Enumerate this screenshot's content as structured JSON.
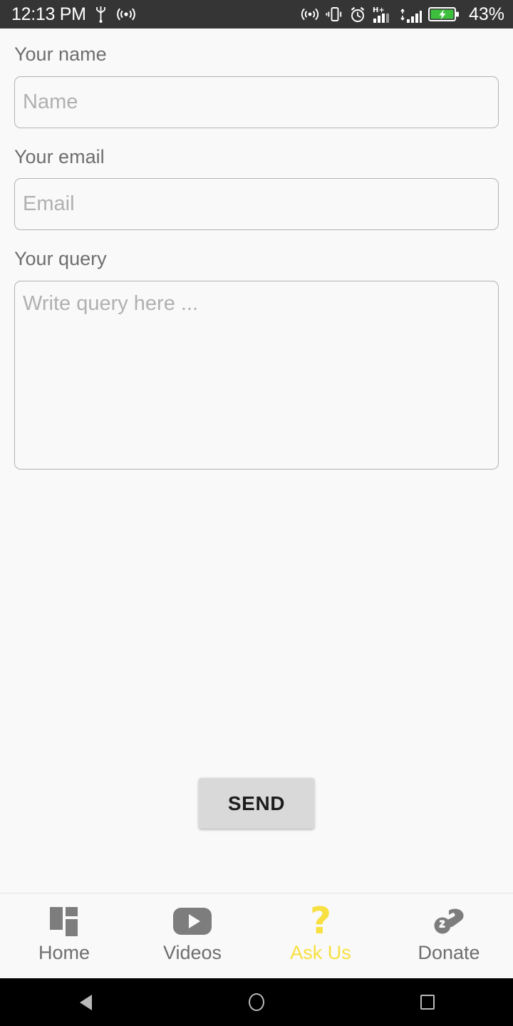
{
  "status_bar": {
    "time": "12:13 PM",
    "battery_percent": "43%",
    "left_icons": [
      "usb-icon",
      "cast-icon"
    ],
    "right_icons": [
      "nfc-icon",
      "vibrate-icon",
      "alarm-icon",
      "hplus-signal-icon",
      "signal-icon",
      "battery-charging-icon"
    ],
    "background_color": "#353535",
    "text_color": "#ffffff"
  },
  "form": {
    "name": {
      "label": "Your name",
      "placeholder": "Name",
      "value": ""
    },
    "email": {
      "label": "Your email",
      "placeholder": "Email",
      "value": ""
    },
    "query": {
      "label": "Your query",
      "placeholder": "Write query here ...",
      "value": ""
    }
  },
  "actions": {
    "send_label": "SEND"
  },
  "bottom_nav": {
    "active_color": "#f7e03f",
    "inactive_color": "#6e6e6e",
    "items": [
      {
        "label": "Home",
        "icon": "grid-dashboard-icon",
        "active": false
      },
      {
        "label": "Videos",
        "icon": "play-video-icon",
        "active": false
      },
      {
        "label": "Ask Us",
        "icon": "question-mark-icon",
        "active": true
      },
      {
        "label": "Donate",
        "icon": "hand-coin-icon",
        "active": false
      }
    ]
  },
  "android_nav": {
    "back_label": "Back",
    "home_label": "Home",
    "recents_label": "Recents"
  }
}
